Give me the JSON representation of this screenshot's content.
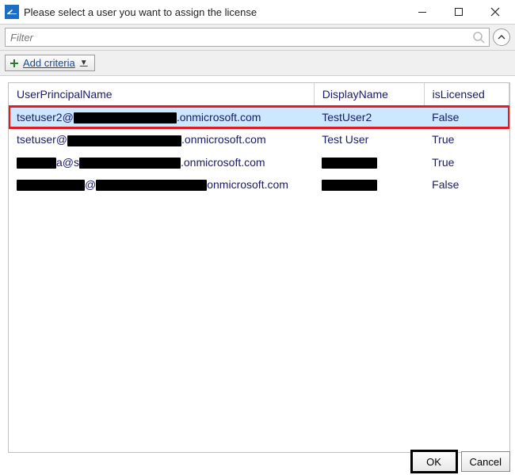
{
  "window": {
    "title": "Please select a user you want to assign the license"
  },
  "filter": {
    "placeholder": "Filter"
  },
  "criteria": {
    "add_label": "Add criteria"
  },
  "grid": {
    "columns": {
      "upn": "UserPrincipalName",
      "display_name": "DisplayName",
      "is_licensed": "isLicensed"
    },
    "rows": [
      {
        "upn_prefix": "tsetuser2@",
        "redact1_w": 130,
        "upn_mid": "",
        "redact2_w": 0,
        "upn_suffix": ".onmicrosoft.com",
        "display_name": "TestUser2",
        "display_redact_w": 0,
        "is_licensed": "False",
        "selected": true
      },
      {
        "upn_prefix": "tsetuser@",
        "redact1_w": 144,
        "upn_mid": "",
        "redact2_w": 0,
        "upn_suffix": ".onmicrosoft.com",
        "display_name": "Test User",
        "display_redact_w": 0,
        "is_licensed": "True",
        "selected": false
      },
      {
        "upn_prefix": "",
        "redact1_w": 50,
        "upn_mid": "a@s",
        "redact2_w": 128,
        "upn_suffix": ".onmicrosoft.com",
        "display_name": "",
        "display_redact_w": 70,
        "is_licensed": "True",
        "selected": false
      },
      {
        "upn_prefix": "",
        "redact1_w": 86,
        "upn_mid": "@",
        "redact2_w": 140,
        "upn_suffix": "onmicrosoft.com",
        "display_name": "",
        "display_redact_w": 70,
        "is_licensed": "False",
        "selected": false
      }
    ]
  },
  "footer": {
    "ok_label": "OK",
    "cancel_label": "Cancel"
  }
}
